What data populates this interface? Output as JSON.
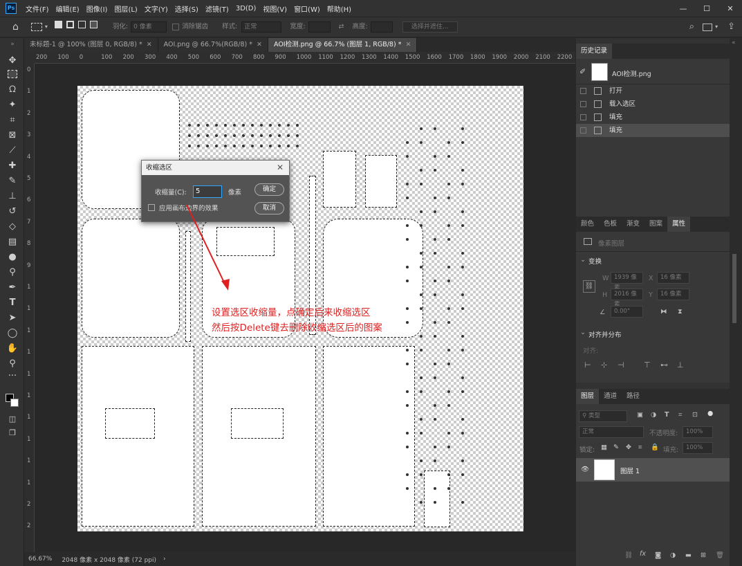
{
  "app": {
    "logo": "Ps"
  },
  "menubar": [
    "文件(F)",
    "编辑(E)",
    "图像(I)",
    "图层(L)",
    "文字(Y)",
    "选择(S)",
    "滤镜(T)",
    "3D(D)",
    "视图(V)",
    "窗口(W)",
    "帮助(H)"
  ],
  "window_controls": {
    "minimize": "—",
    "restore": "☐",
    "close": "✕"
  },
  "options": {
    "feather_label": "羽化:",
    "feather_value": "0 像素",
    "antialias_label": "消除锯齿",
    "style_label": "样式:",
    "style_value": "正常",
    "width_label": "宽度:",
    "height_label": "高度:",
    "select_mask_button": "选择并遮住..."
  },
  "tabs": [
    {
      "label": "未标题-1 @ 100% (图层 0, RGB/8) *",
      "active": false
    },
    {
      "label": "AOI.png @ 66.7%(RGB/8) *",
      "active": false
    },
    {
      "label": "AOI检测.png @ 66.7% (图层 1, RGB/8) *",
      "active": true
    }
  ],
  "ruler_labels": [
    "200",
    "100",
    "0",
    "100",
    "200",
    "300",
    "400",
    "500",
    "600",
    "700",
    "800",
    "900",
    "1000",
    "1100",
    "1200",
    "1300",
    "1400",
    "1500",
    "1600",
    "1700",
    "1800",
    "1900",
    "2000",
    "2100",
    "2200"
  ],
  "vruler_labels": [
    "0",
    "1",
    "2",
    "3",
    "4",
    "5",
    "6",
    "7",
    "8",
    "9",
    "1",
    "1",
    "1",
    "1",
    "1",
    "1",
    "1",
    "1",
    "1",
    "1",
    "2",
    "2"
  ],
  "dialog": {
    "title": "收缩选区",
    "amount_label": "收缩量(C):",
    "amount_value": "5",
    "unit": "像素",
    "apply_edge_label": "应用画布边界的效果",
    "ok": "确定",
    "cancel": "取消"
  },
  "annotation": {
    "line1": "设置选区收缩量，点确定后来收缩选区",
    "line2": "然后按Delete键去删除收缩选区后的图案"
  },
  "status": {
    "zoom": "66.67%",
    "info": "2048 像素 x 2048 像素 (72 ppi)",
    "arrow": "›"
  },
  "history": {
    "tab": "历史记录",
    "snapshot": "AOI检测.png",
    "items": [
      "打开",
      "载入选区",
      "填充",
      "填充"
    ]
  },
  "props_tabs": [
    "颜色",
    "色板",
    "渐变",
    "图案",
    "属性"
  ],
  "properties": {
    "pixel_layer": "像素图层",
    "transform": "变换",
    "w_label": "W",
    "w_value": "1939 像素",
    "x_label": "X",
    "x_value": "16 像素",
    "h_label": "H",
    "h_value": "2016 像素",
    "y_label": "Y",
    "y_value": "16 像素",
    "angle_value": "0.00°",
    "align": "对齐并分布",
    "align_label": "对齐:"
  },
  "layers_panel": {
    "tabs": [
      "图层",
      "通道",
      "路径"
    ],
    "filter_label": "类型",
    "blend_mode": "正常",
    "opacity_label": "不透明度:",
    "opacity_value": "100%",
    "lock_label": "锁定:",
    "fill_label": "填充:",
    "fill_value": "100%",
    "layer_name": "图层 1"
  }
}
